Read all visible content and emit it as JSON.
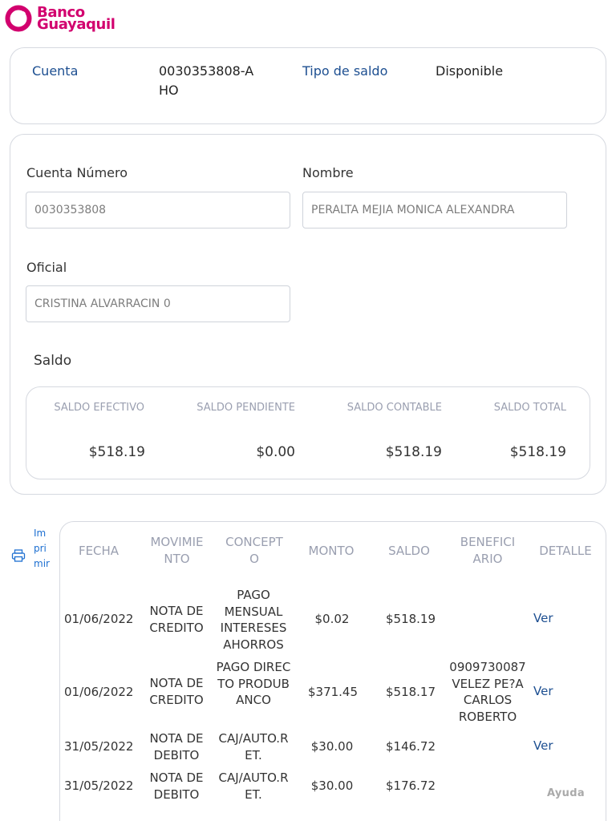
{
  "brand": {
    "line1": "Banco",
    "line2": "Guayaquil",
    "color": "#d2006e"
  },
  "summary": {
    "cuenta_label": "Cuenta",
    "cuenta_value": "0030353808-AHO",
    "tipo_label": "Tipo de saldo",
    "tipo_value": "Disponible"
  },
  "form": {
    "cuenta_numero_label": "Cuenta Número",
    "cuenta_numero_value": "0030353808",
    "nombre_label": "Nombre",
    "nombre_value": "PERALTA MEJIA MONICA ALEXANDRA",
    "oficial_label": "Oficial",
    "oficial_value": "CRISTINA ALVARRACIN 0"
  },
  "saldo": {
    "title": "Saldo",
    "headers": [
      "SALDO EFECTIVO",
      "SALDO PENDIENTE",
      "SALDO CONTABLE",
      "SALDO TOTAL"
    ],
    "values": [
      "$518.19",
      "$0.00",
      "$518.19",
      "$518.19"
    ]
  },
  "print": {
    "label": "Imprimir",
    "icon": "printer-icon"
  },
  "table": {
    "headers": [
      "FECHA",
      "MOVIMIENTO",
      "CONCEPTO",
      "MONTO",
      "SALDO",
      "BENEFICIARIO",
      "DETALLE"
    ],
    "rows": [
      {
        "fecha": "01/06/2022",
        "movimiento": "NOTA DE CREDITO",
        "concepto": "PAGO MENSUAL INTERESES AHORROS",
        "monto": "$0.02",
        "saldo": "$518.19",
        "beneficiario": "",
        "detalle": "Ver"
      },
      {
        "fecha": "01/06/2022",
        "movimiento": "NOTA DE CREDITO",
        "concepto": "PAGO DIRECTO PRODUBANCO",
        "monto": "$371.45",
        "saldo": "$518.17",
        "beneficiario": "0909730087 VELEZ PE?A CARLOS ROBERTO",
        "detalle": "Ver"
      },
      {
        "fecha": "31/05/2022",
        "movimiento": "NOTA DE DEBITO",
        "concepto": "CAJ/AUTO.RET.",
        "monto": "$30.00",
        "saldo": "$146.72",
        "beneficiario": "",
        "detalle": "Ver"
      },
      {
        "fecha": "31/05/2022",
        "movimiento": "NOTA DE DEBITO",
        "concepto": "CAJ/AUTO.RET.",
        "monto": "$30.00",
        "saldo": "$176.72",
        "beneficiario": "",
        "detalle": ""
      }
    ]
  },
  "help": {
    "label": "Ayuda"
  }
}
